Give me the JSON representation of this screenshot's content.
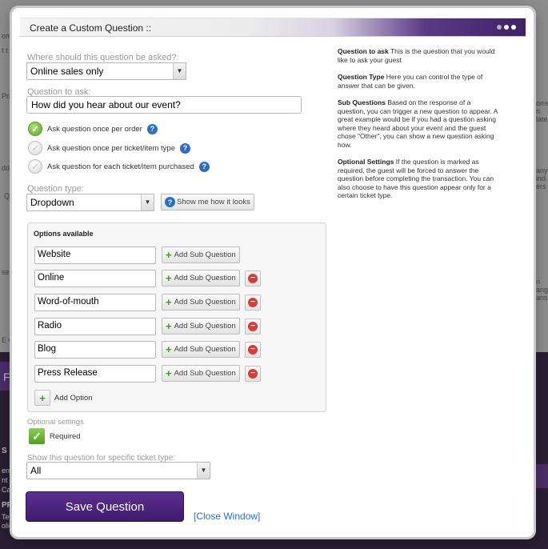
{
  "background": {
    "fragments": [
      "om",
      "t t",
      "Pri",
      "dd",
      "Q",
      "se",
      "E C",
      "F",
      "S",
      "ent",
      "nt",
      "Can",
      "PR",
      "Terr",
      "olic",
      "ome",
      "n",
      "late",
      "any",
      "ind",
      "ers",
      "n",
      "ang",
      "ans"
    ]
  },
  "modal": {
    "title": "Create a Custom Question ::",
    "ask_where_label": "Where should this question be asked?:",
    "ask_where_value": "Online sales only",
    "question_label": "Question to ask:",
    "question_value": "How did you hear about our event?",
    "frequency_options": [
      {
        "label": "Ask question once per order",
        "checked": true
      },
      {
        "label": "Ask question once per ticket/item type",
        "checked": false
      },
      {
        "label": "Ask question for each ticket/item purchased",
        "checked": false
      }
    ],
    "question_type_label": "Question type:",
    "question_type_value": "Dropdown",
    "show_me_label": "Show me how it looks",
    "options_title": "Options available",
    "options": [
      "Website",
      "Online",
      "Word-of-mouth",
      "Radio",
      "Blog",
      "Press Release"
    ],
    "add_sub_question_label": "Add Sub Question",
    "add_option_label": "Add Option",
    "optional_settings_label": "Optional settings",
    "required_label": "Required",
    "ticket_type_label": "Show this question for specific ticket type:",
    "ticket_type_value": "All",
    "save_label": "Save Question",
    "close_label": "[Close Window]"
  },
  "help": {
    "items": [
      {
        "title": "Question to ask",
        "text": "This is the question that you would like to ask your guest"
      },
      {
        "title": "Question Type",
        "text": "Here you can control the type of answer that can be given."
      },
      {
        "title": "Sub Questions",
        "text": "Based on the response of a question, you can trigger a new question to appear. A great example would be if you had a question asking where they heard about your event and the guest chose \"Other\", you can show a new question asking how."
      },
      {
        "title": "Optional Settings",
        "text": "If the question is marked as required, the guest will be forced to answer the question before completing the transaction. You can also choose to have this question appear only for a certain ticket type."
      }
    ]
  },
  "colors": {
    "accent": "#4a2576",
    "link": "#2a6fc4",
    "check_green": "#5fa52a",
    "remove_red": "#d93b3b"
  }
}
